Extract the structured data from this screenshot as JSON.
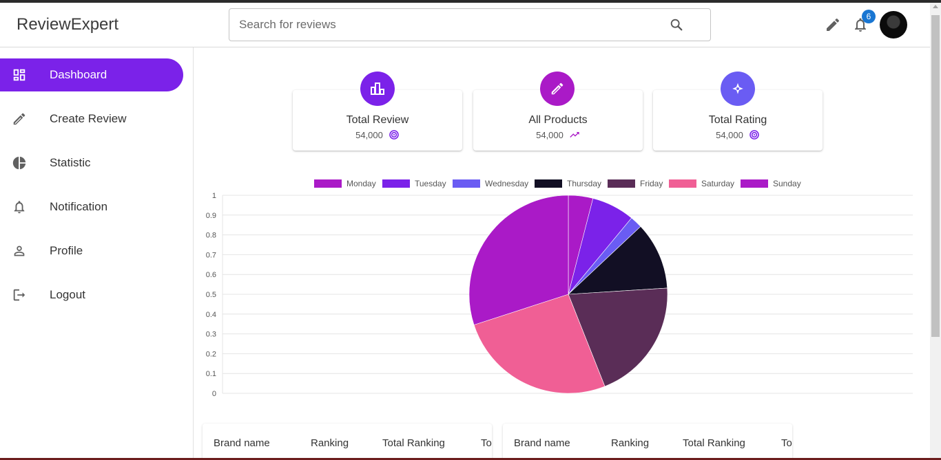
{
  "header": {
    "brand": "ReviewExpert",
    "search_placeholder": "Search for reviews",
    "notification_count": "6"
  },
  "sidebar": {
    "items": [
      {
        "label": "Dashboard",
        "icon": "dashboard-icon",
        "active": true
      },
      {
        "label": "Create Review",
        "icon": "pencil-icon"
      },
      {
        "label": "Statistic",
        "icon": "pie-chart-icon"
      },
      {
        "label": "Notification",
        "icon": "bell-icon"
      },
      {
        "label": "Profile",
        "icon": "person-icon"
      },
      {
        "label": "Logout",
        "icon": "logout-icon"
      }
    ]
  },
  "cards": [
    {
      "title": "Total Review",
      "value": "54,000",
      "icon": "bar-chart-icon",
      "trend_icon": "spiral-icon",
      "color": "#7b22e9"
    },
    {
      "title": "All Products",
      "value": "54,000",
      "icon": "pencil-icon",
      "trend_icon": "trending-up-icon",
      "color": "#aa1ac7"
    },
    {
      "title": "Total Rating",
      "value": "54,000",
      "icon": "star-sparkle-icon",
      "trend_icon": "spiral-icon",
      "color": "#6a5cf3"
    }
  ],
  "chart_data": {
    "type": "pie",
    "categories": [
      "Monday",
      "Tuesday",
      "Wednesday",
      "Thursday",
      "Friday",
      "Saturday",
      "Sunday"
    ],
    "values": [
      4,
      7,
      2,
      11,
      20,
      26,
      30
    ],
    "colors": [
      "#aa1ac7",
      "#7b22e9",
      "#6a5cf3",
      "#120f24",
      "#5a2d57",
      "#f05f95",
      "#aa1ac7"
    ],
    "yticks": [
      "1",
      "0.9",
      "0.8",
      "0.7",
      "0.6",
      "0.5",
      "0.4",
      "0.3",
      "0.2",
      "0.1",
      "0"
    ],
    "legend_position": "top"
  },
  "tables": [
    {
      "headers": [
        "Brand name",
        "Ranking",
        "Total Ranking",
        "To"
      ]
    },
    {
      "headers": [
        "Brand name",
        "Ranking",
        "Total Ranking",
        "To"
      ]
    }
  ]
}
